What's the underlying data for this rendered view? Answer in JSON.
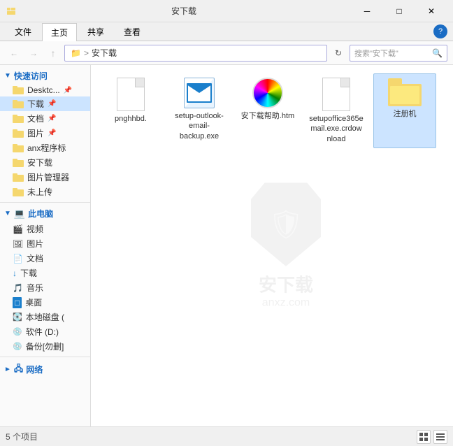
{
  "titleBar": {
    "title": "安下载",
    "minimize": "─",
    "maximize": "□",
    "close": "✕"
  },
  "ribbon": {
    "tabs": [
      "文件",
      "主页",
      "共享",
      "查看"
    ],
    "activeTab": "主页",
    "helpIcon": "?"
  },
  "addressBar": {
    "back": "←",
    "forward": "→",
    "up": "↑",
    "path": "安下载",
    "pathFull": " 安下载",
    "refresh": "↻",
    "searchPlaceholder": "搜索\"安下载\""
  },
  "sidebar": {
    "quickAccess": {
      "label": "快速访问",
      "items": [
        {
          "name": "Desktc...",
          "pinned": true,
          "type": "folder"
        },
        {
          "name": "下载",
          "pinned": true,
          "type": "folder-active"
        },
        {
          "name": "文档",
          "pinned": true,
          "type": "folder"
        },
        {
          "name": "图片",
          "pinned": true,
          "type": "folder"
        },
        {
          "name": "anx程序标",
          "type": "folder"
        },
        {
          "name": "安下载",
          "type": "folder"
        },
        {
          "name": "图片管理器",
          "type": "folder"
        },
        {
          "name": "未上传",
          "type": "folder"
        }
      ]
    },
    "computer": {
      "label": "此电脑",
      "items": [
        {
          "name": "视频",
          "type": "video"
        },
        {
          "name": "图片",
          "type": "pictures"
        },
        {
          "name": "文档",
          "type": "documents"
        },
        {
          "name": "下载",
          "type": "download"
        },
        {
          "name": "音乐",
          "type": "music"
        },
        {
          "name": "桌面",
          "type": "desktop"
        },
        {
          "name": "本地磁盘 (",
          "type": "drive"
        },
        {
          "name": "软件 (D:)",
          "type": "drive"
        },
        {
          "name": "备份[勿删]",
          "type": "drive"
        }
      ]
    },
    "network": {
      "label": "网络"
    }
  },
  "files": [
    {
      "id": 1,
      "name": "pnghhbd.",
      "type": "doc",
      "selected": false
    },
    {
      "id": 2,
      "name": "setup-outlook-email-backup.exe",
      "type": "email",
      "selected": false
    },
    {
      "id": 3,
      "name": "安下载帮助.htm",
      "type": "colorful",
      "selected": false
    },
    {
      "id": 4,
      "name": "setupoffice365email.exe.crdow nload",
      "type": "doc",
      "selected": false
    },
    {
      "id": 5,
      "name": "注册机",
      "type": "folder",
      "selected": true
    }
  ],
  "statusBar": {
    "count": "5 个项目",
    "viewGrid": "▦",
    "viewList": "☰"
  },
  "watermark": {
    "text": "安下载",
    "sub": "anxz.com"
  }
}
